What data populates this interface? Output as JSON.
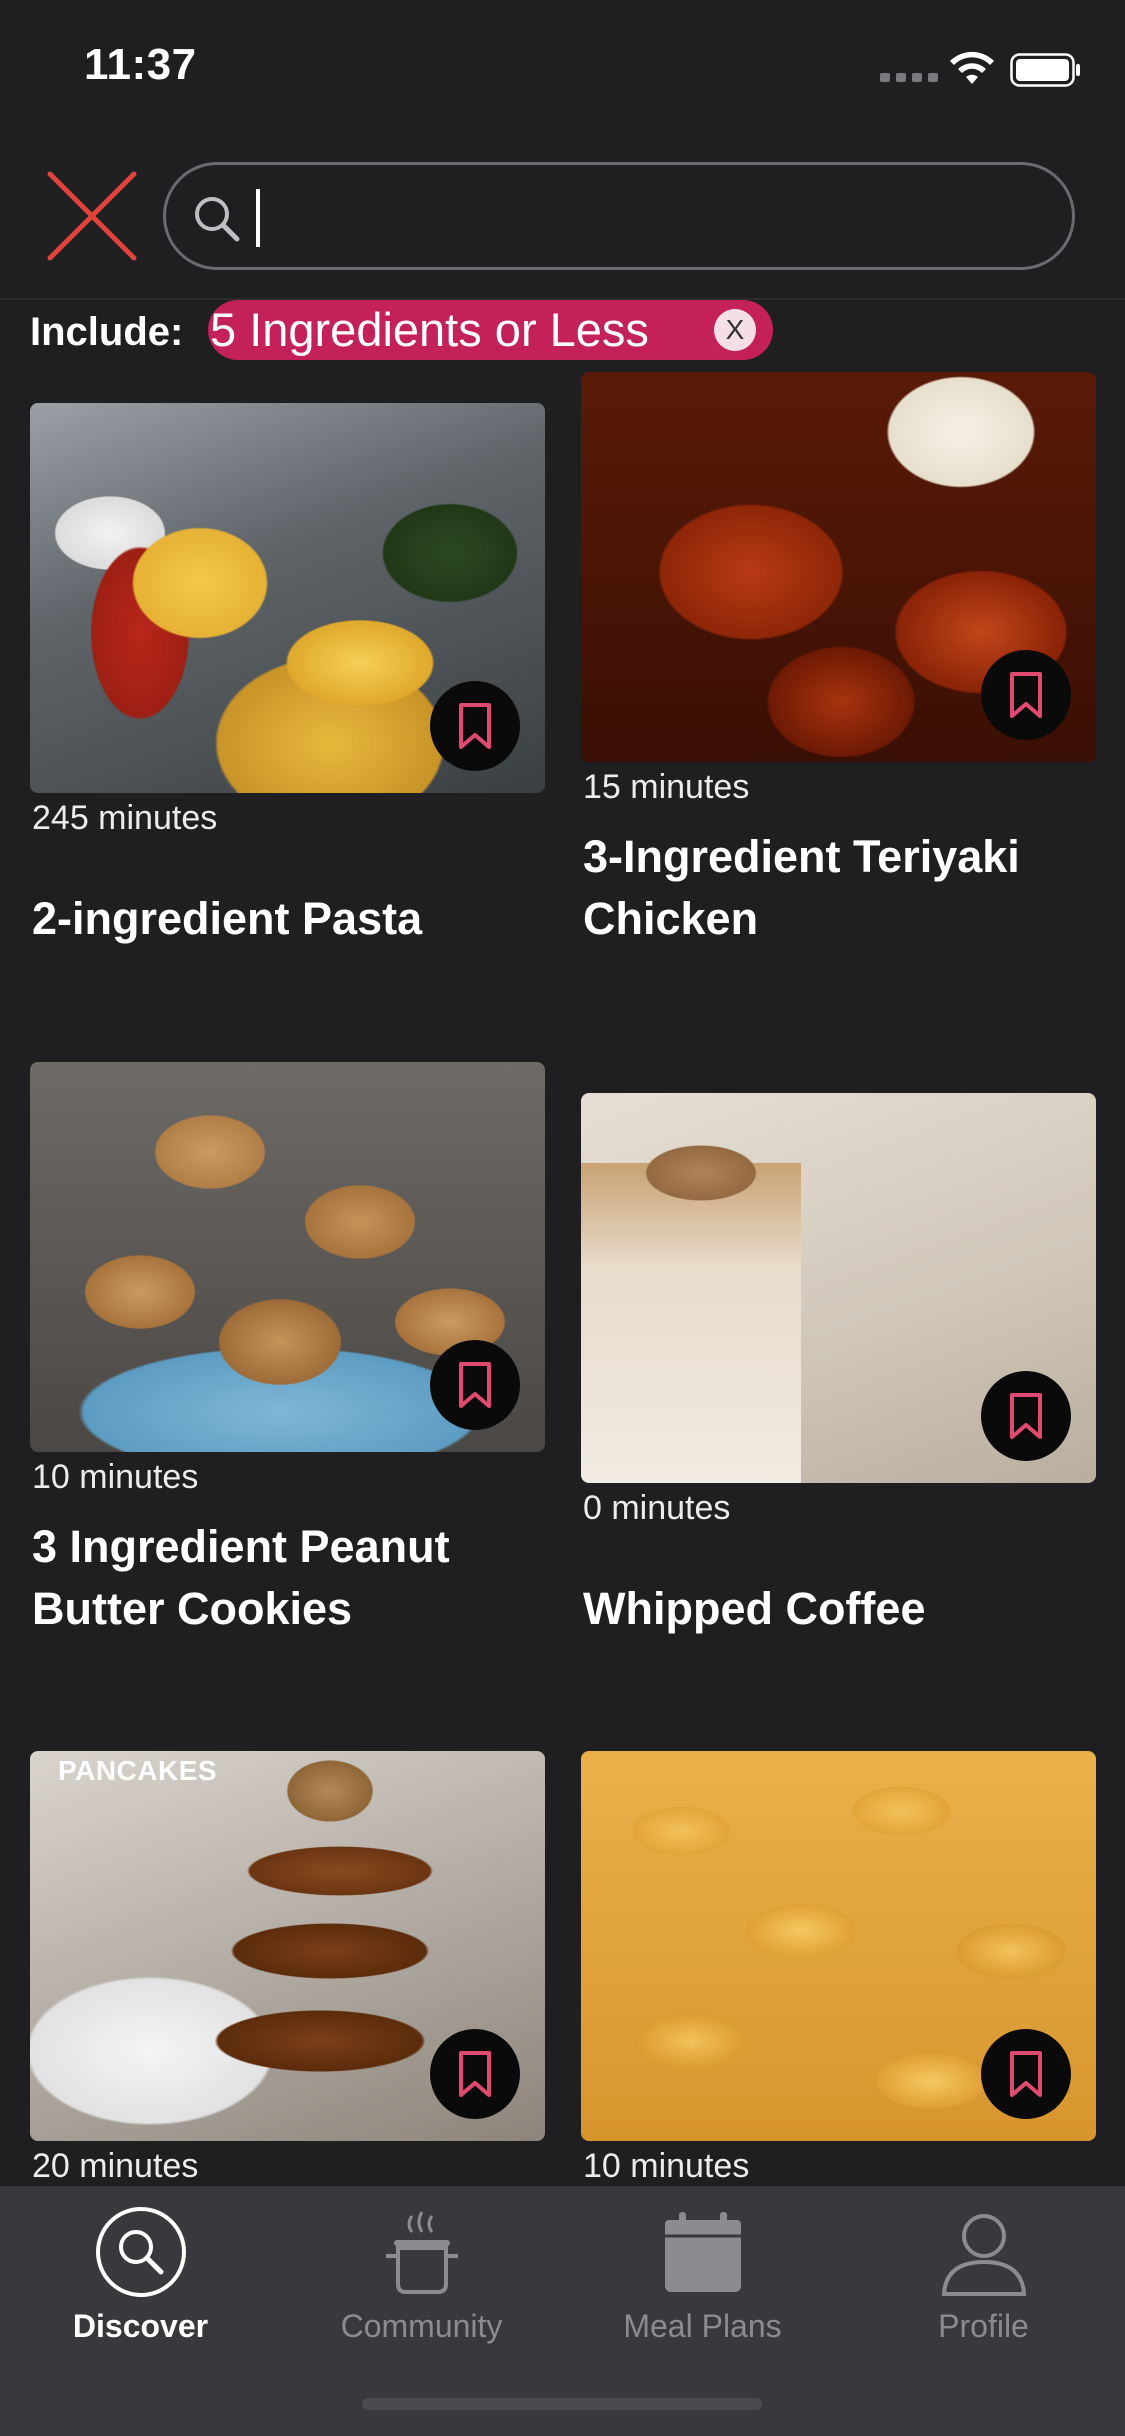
{
  "status_bar": {
    "time": "11:37"
  },
  "search": {
    "placeholder": "",
    "value": ""
  },
  "filter": {
    "label": "Include:",
    "chip_text": "5 Ingredients or Less",
    "chip_close": "X"
  },
  "recipes": [
    {
      "minutes": "245 minutes",
      "title": "2-ingredient Pasta",
      "image": "pasta-image"
    },
    {
      "minutes": "15 minutes",
      "title": "3-Ingredient Teriyaki Chicken",
      "image": "teriyaki-chicken-image"
    },
    {
      "minutes": "10 minutes",
      "title": "3 Ingredient Peanut Butter Cookies",
      "image": "peanut-butter-cookies-image"
    },
    {
      "minutes": "0 minutes",
      "title": "Whipped Coffee",
      "image": "whipped-coffee-image"
    },
    {
      "minutes": "20 minutes",
      "title": "",
      "image": "pancakes-image",
      "image_text": "PANCAKES"
    },
    {
      "minutes": "10 minutes",
      "title": "",
      "image": "mac-and-cheese-image"
    }
  ],
  "tabs": [
    {
      "label": "Discover",
      "icon": "search-icon",
      "active": true
    },
    {
      "label": "Community",
      "icon": "cooking-pot-icon",
      "active": false
    },
    {
      "label": "Meal Plans",
      "icon": "calendar-icon",
      "active": false
    },
    {
      "label": "Profile",
      "icon": "person-icon",
      "active": false
    }
  ],
  "colors": {
    "background": "#1f1f22",
    "accent": "#c4215a",
    "close_red": "#e0433b",
    "tabbar": "#39393d"
  }
}
